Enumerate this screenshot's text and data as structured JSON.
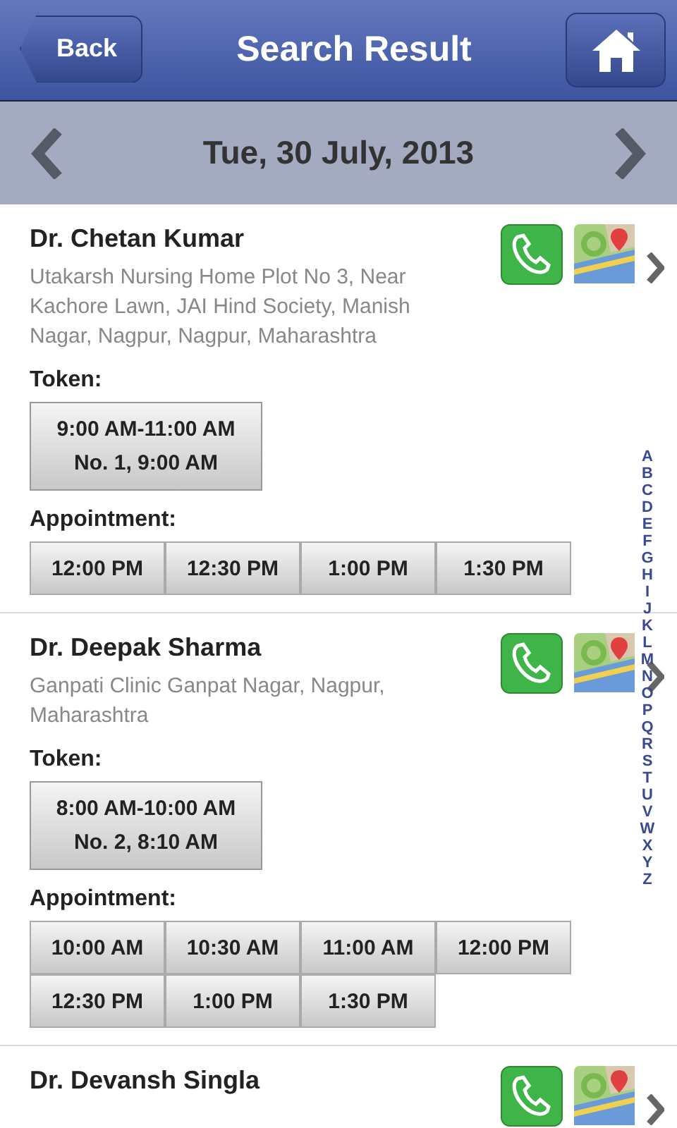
{
  "header": {
    "back": "Back",
    "title": "Search Result"
  },
  "date_bar": {
    "date": "Tue, 30 July, 2013"
  },
  "doctors": [
    {
      "name": "Dr. Chetan Kumar",
      "address": "Utakarsh Nursing Home Plot No 3, Near Kachore Lawn, JAI Hind Society, Manish Nagar, Nagpur, Nagpur, Maharashtra",
      "token_label": "Token:",
      "token": [
        "9:00 AM-11:00 AM",
        "No. 1, 9:00 AM"
      ],
      "appointment_label": "Appointment:",
      "slots": [
        "12:00 PM",
        "12:30 PM",
        "1:00 PM",
        "1:30 PM"
      ]
    },
    {
      "name": "Dr. Deepak Sharma",
      "address": "Ganpati Clinic Ganpat Nagar, Nagpur, Maharashtra",
      "token_label": "Token:",
      "token": [
        "8:00 AM-10:00 AM",
        "No. 2, 8:10 AM"
      ],
      "appointment_label": "Appointment:",
      "slots": [
        "10:00 AM",
        "10:30 AM",
        "11:00 AM",
        "12:00 PM",
        "12:30 PM",
        "1:00 PM",
        "1:30 PM"
      ]
    },
    {
      "name": "Dr. Devansh Singla"
    }
  ],
  "index_letters": [
    "A",
    "B",
    "C",
    "D",
    "E",
    "F",
    "G",
    "H",
    "I",
    "J",
    "K",
    "L",
    "M",
    "N",
    "O",
    "P",
    "Q",
    "R",
    "S",
    "T",
    "U",
    "V",
    "W",
    "X",
    "Y",
    "Z"
  ]
}
